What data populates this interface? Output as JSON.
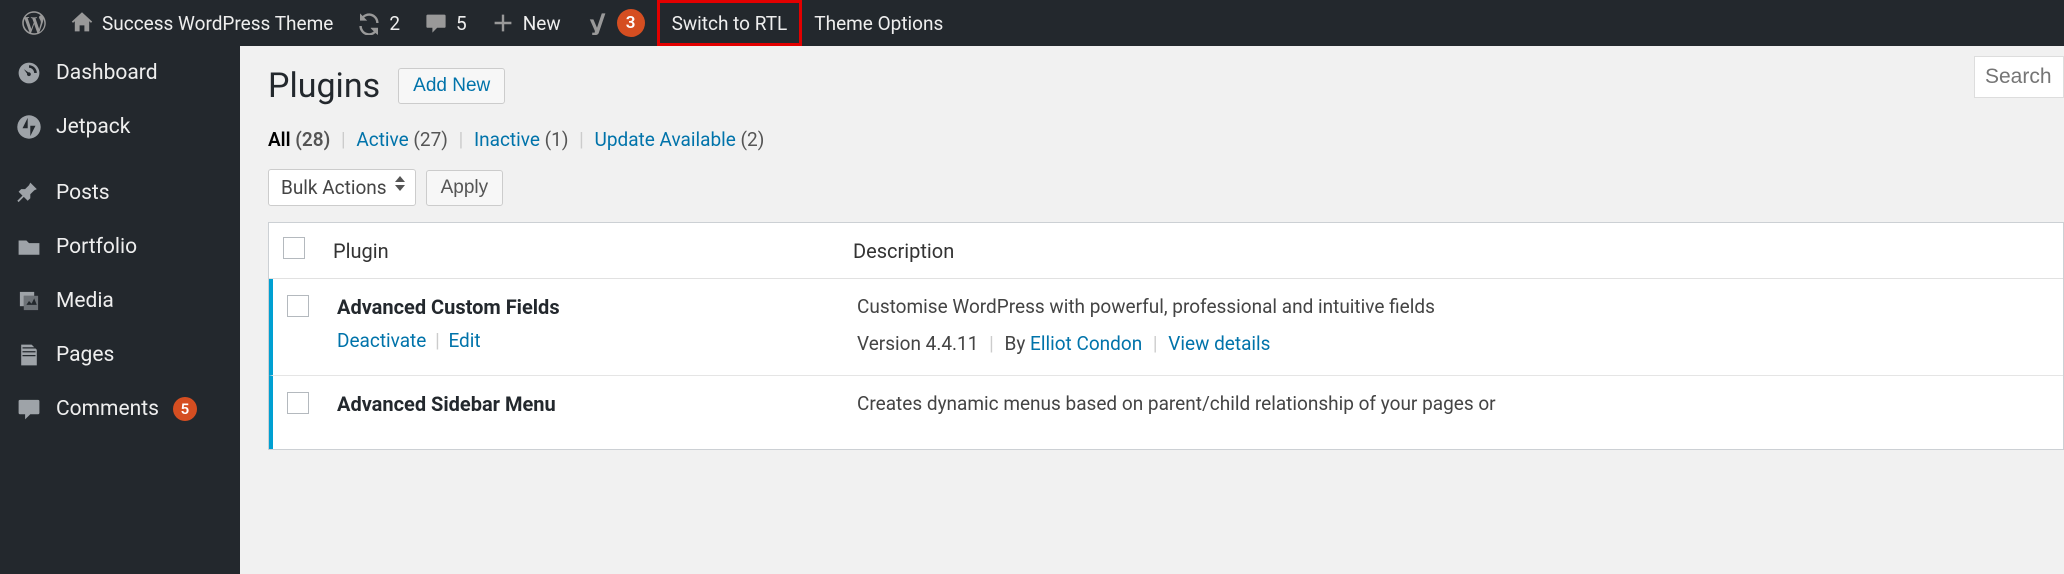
{
  "adminbar": {
    "site_title": "Success WordPress Theme",
    "refresh_count": "2",
    "comment_count": "5",
    "new_label": "New",
    "seo_badge": "3",
    "rtl_label": "Switch to RTL",
    "theme_options_label": "Theme Options"
  },
  "sidebar": {
    "items": [
      {
        "label": "Dashboard"
      },
      {
        "label": "Jetpack"
      },
      {
        "label": "Posts"
      },
      {
        "label": "Portfolio"
      },
      {
        "label": "Media"
      },
      {
        "label": "Pages"
      },
      {
        "label": "Comments",
        "badge": "5"
      }
    ]
  },
  "page": {
    "title": "Plugins",
    "add_new": "Add New",
    "search_placeholder": "Search"
  },
  "filters": {
    "all_label": "All",
    "all_count": "(28)",
    "active_label": "Active",
    "active_count": "(27)",
    "inactive_label": "Inactive",
    "inactive_count": "(1)",
    "update_label": "Update Available",
    "update_count": "(2)"
  },
  "bulk": {
    "select_label": "Bulk Actions",
    "apply_label": "Apply"
  },
  "table": {
    "col_plugin": "Plugin",
    "col_desc": "Description",
    "rows": [
      {
        "name": "Advanced Custom Fields",
        "action_deactivate": "Deactivate",
        "action_edit": "Edit",
        "desc": "Customise WordPress with powerful, professional and intuitive fields",
        "version_prefix": "Version 4.4.11",
        "by": "By ",
        "author": "Elliot Condon",
        "view": "View details"
      },
      {
        "name": "Advanced Sidebar Menu",
        "desc": "Creates dynamic menus based on parent/child relationship of your pages or"
      }
    ]
  }
}
